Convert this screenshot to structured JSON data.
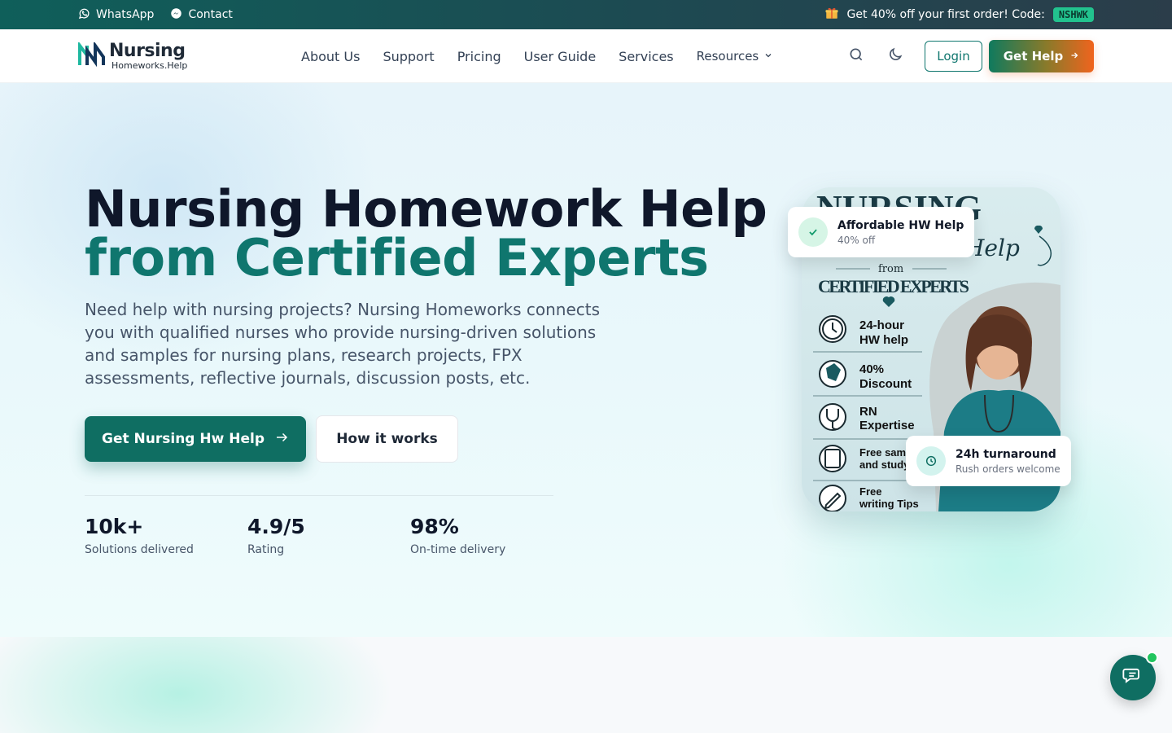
{
  "topbar": {
    "whatsapp_label": "WhatsApp",
    "contact_label": "Contact",
    "promo_text": "Get 40% off your first order! Code:",
    "promo_code": "NSHWK"
  },
  "logo": {
    "title": "Nursing",
    "subtitle": "Homeworks.Help"
  },
  "nav": {
    "items": [
      "About Us",
      "Support",
      "Pricing",
      "User Guide",
      "Services"
    ],
    "resources_label": "Resources",
    "login_label": "Login",
    "get_help_label": "Get Help"
  },
  "hero": {
    "headline_line1": "Nursing Homework Help",
    "headline_line2": "from Certified Experts",
    "lead": "Need help with nursing projects? Nursing Homeworks connects you with qualified nurses who provide nursing-driven solutions and samples for nursing plans, research projects, FPX assessments, reflective journals, discussion posts, etc.",
    "cta_primary": "Get Nursing Hw Help",
    "cta_secondary": "How it works",
    "stats": [
      {
        "value": "10k+",
        "label": "Solutions delivered"
      },
      {
        "value": "4.9/5",
        "label": "Rating"
      },
      {
        "value": "98%",
        "label": "On-time delivery"
      }
    ]
  },
  "card": {
    "top_word": "NURSING",
    "script_word": "Help",
    "from": "from",
    "experts": "CERTIFIED EXPERTS",
    "features": [
      {
        "line1": "24-hour",
        "line2": "HW help"
      },
      {
        "line1": "40%",
        "line2": "Discount"
      },
      {
        "line1": "RN",
        "line2": "Expertise"
      },
      {
        "line1": "Free samp",
        "line2": "and study"
      },
      {
        "line1": "Free",
        "line2": "writing Tips"
      }
    ]
  },
  "badges": {
    "affordable_title": "Affordable HW Help",
    "affordable_sub": "40% off",
    "turnaround_title": "24h turnaround",
    "turnaround_sub": "Rush orders welcome"
  },
  "colors": {
    "brand": "#0f766e",
    "accent_orange": "#f0641e",
    "code_badge": "#22c38e",
    "online_dot": "#22c55e"
  },
  "icons": [
    "whatsapp-icon",
    "messenger-icon",
    "gift-icon",
    "search-icon",
    "moon-icon",
    "chevron-down-icon",
    "arrow-right-icon",
    "check-icon",
    "clock-icon",
    "chat-icon"
  ]
}
